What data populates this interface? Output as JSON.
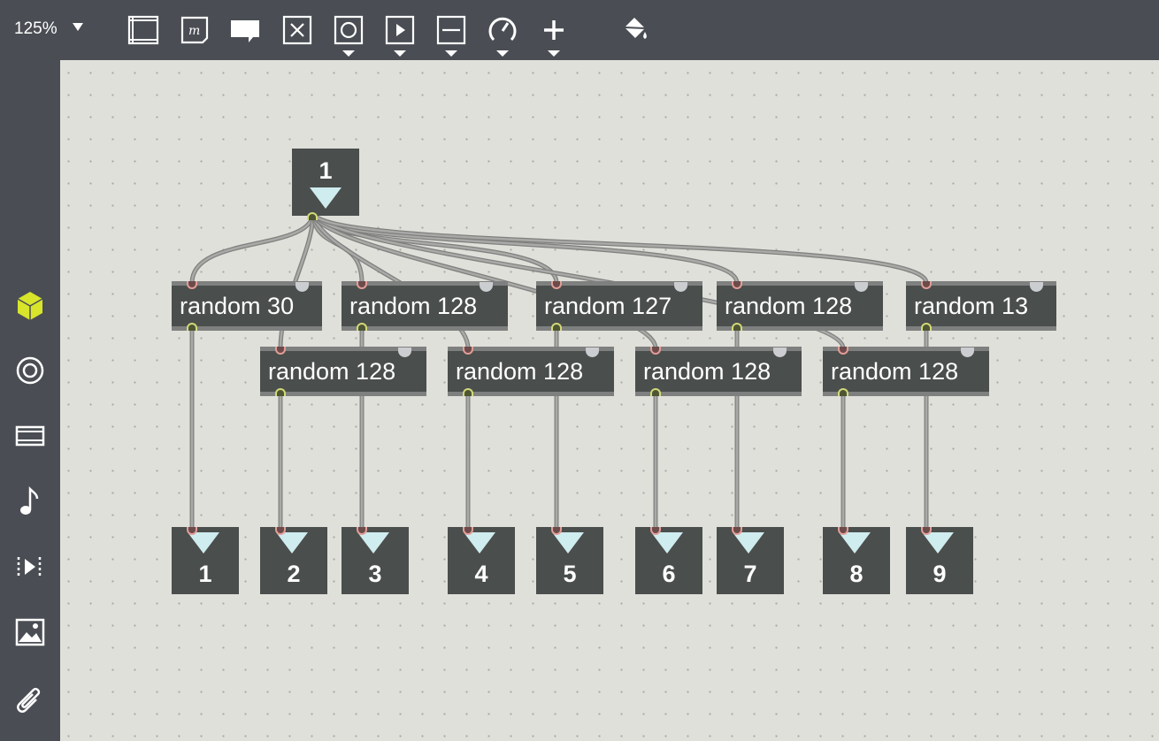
{
  "toolbar": {
    "zoom": "125%",
    "tools": [
      {
        "icon": "panel-icon"
      },
      {
        "icon": "message-icon"
      },
      {
        "icon": "comment-icon"
      },
      {
        "icon": "toggle-icon"
      },
      {
        "icon": "bang-icon"
      },
      {
        "icon": "play-icon"
      },
      {
        "icon": "slider-icon"
      },
      {
        "icon": "dial-icon"
      },
      {
        "icon": "add-object-icon"
      },
      {
        "icon": "paint-bucket-icon"
      }
    ]
  },
  "sidebar": {
    "items": [
      {
        "icon": "package-cube-icon",
        "color": "#d8e52a"
      },
      {
        "icon": "target-icon"
      },
      {
        "icon": "film-strip-icon"
      },
      {
        "icon": "music-note-icon"
      },
      {
        "icon": "step-forward-icon"
      },
      {
        "icon": "image-icon"
      },
      {
        "icon": "paperclip-icon"
      }
    ]
  },
  "patch": {
    "source_number": "1",
    "random_objects": [
      {
        "text": "random 30"
      },
      {
        "text": "random 128"
      },
      {
        "text": "random 127"
      },
      {
        "text": "random 128"
      },
      {
        "text": "random 13"
      },
      {
        "text": "random 128"
      },
      {
        "text": "random 128"
      },
      {
        "text": "random 128"
      },
      {
        "text": "random 128"
      }
    ],
    "output_numbers": [
      "1",
      "2",
      "3",
      "4",
      "5",
      "6",
      "7",
      "8",
      "9"
    ]
  },
  "colors": {
    "toolbar_bg": "#4a4e54",
    "canvas_bg": "#e0e0db",
    "object_bg": "#4a4e4c",
    "cord": "#9a9a98",
    "accent": "#d8e52a",
    "inlet": "#e39d97",
    "outlet": "#d4d87a",
    "number_triangle": "#cfecef"
  }
}
